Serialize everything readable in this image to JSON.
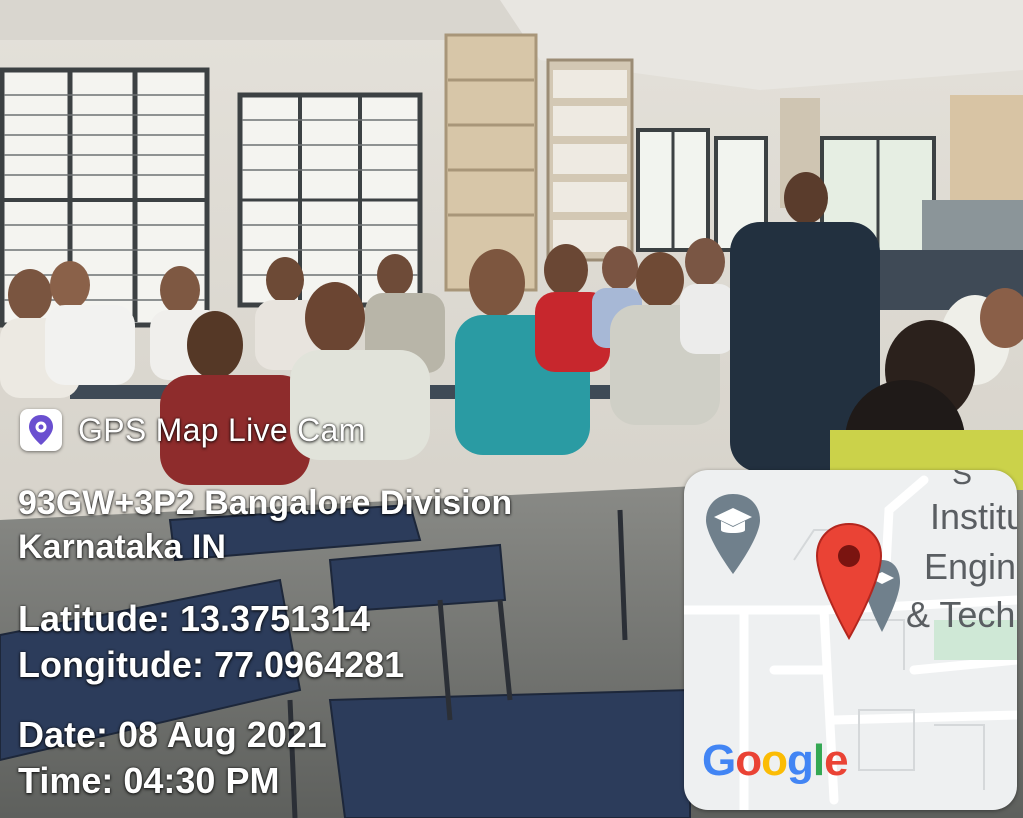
{
  "app": {
    "name": "GPS Map Live Cam",
    "icon": "location-pin-icon"
  },
  "address": {
    "line1": "93GW+3P2 Bangalore Division",
    "line2": "Karnataka IN"
  },
  "coordinates": {
    "latitude": "Latitude: 13.3751314",
    "longitude": "Longitude: 77.0964281"
  },
  "datetime": {
    "date": "Date: 08 Aug 2021",
    "time": "Time: 04:30 PM"
  },
  "map": {
    "labels": [
      "S",
      "Institu",
      "Engin",
      "& Tech"
    ],
    "google_letters": [
      "G",
      "o",
      "o",
      "g",
      "l",
      "e"
    ],
    "google_colors": [
      "#4285F4",
      "#EA4335",
      "#FBBC05",
      "#4285F4",
      "#34A853",
      "#EA4335"
    ],
    "marker_color": "#EA4335",
    "school_pin_color": "#70808c",
    "icons": [
      "school-pin-icon",
      "school-pin-icon",
      "map-marker-icon"
    ]
  }
}
